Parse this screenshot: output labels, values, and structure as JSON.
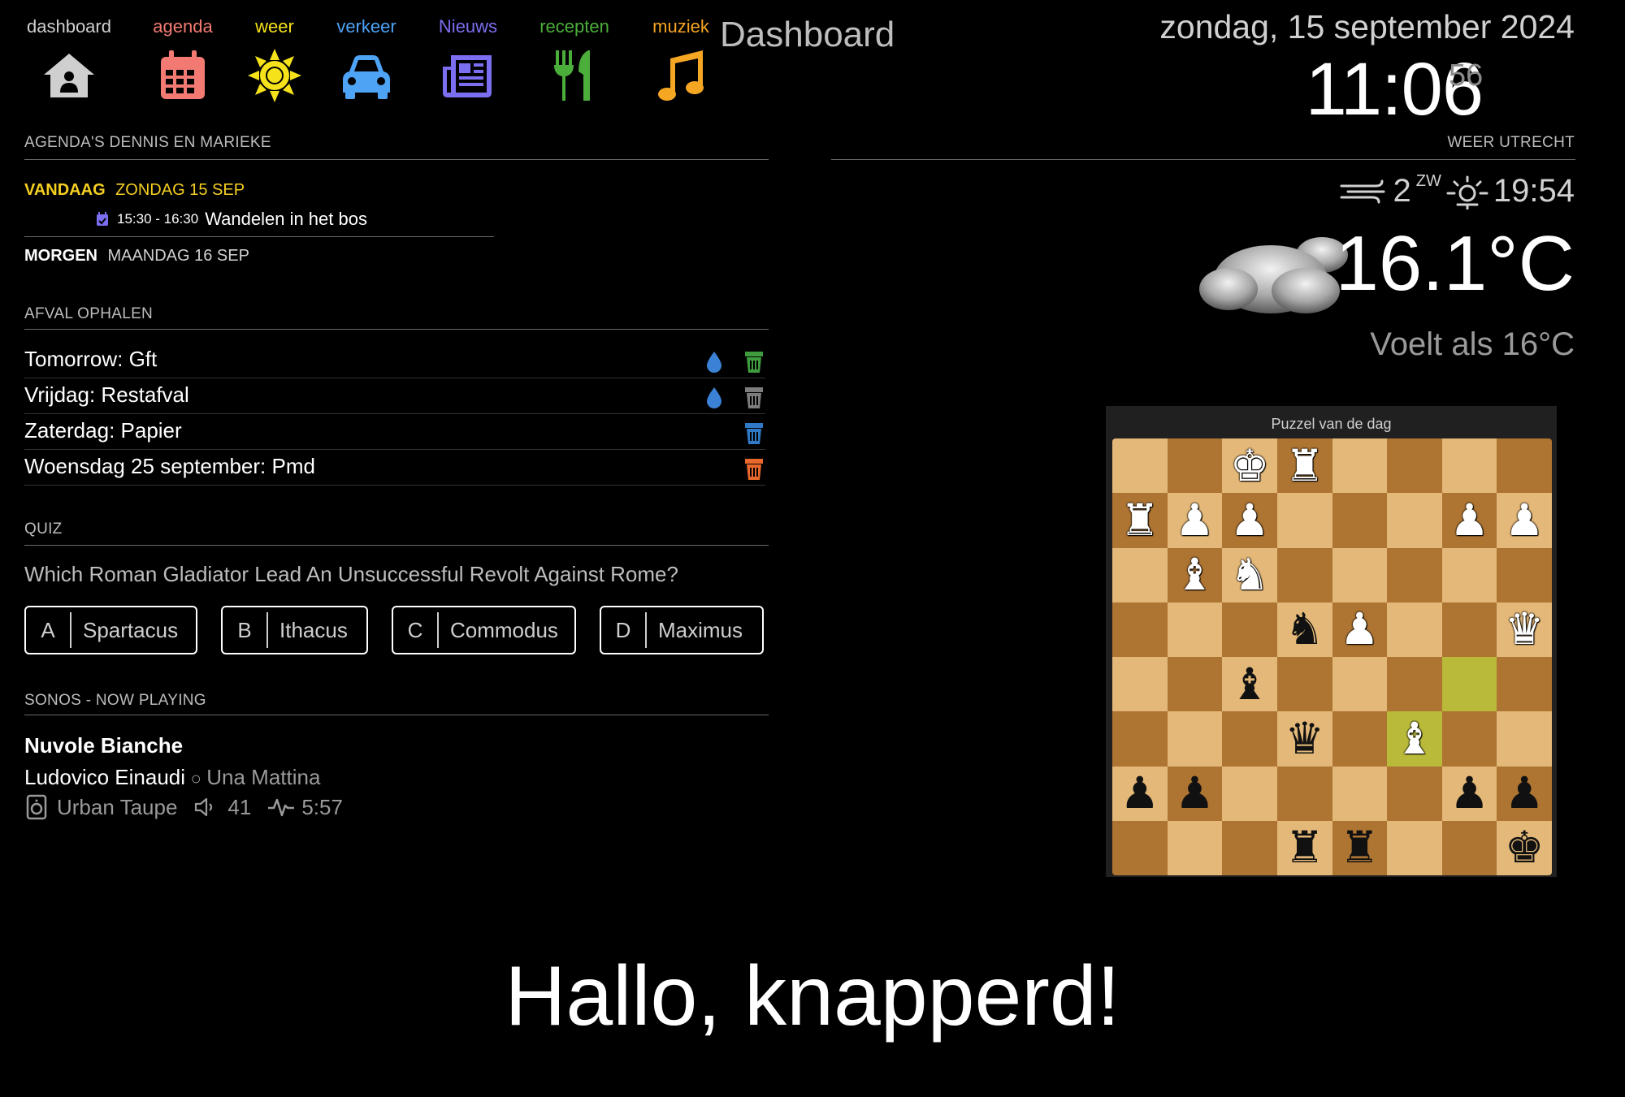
{
  "nav": [
    {
      "label": "dashboard",
      "color": "#cfcfcf",
      "icon": "home-icon"
    },
    {
      "label": "agenda",
      "color": "#f27a73",
      "icon": "calendar-icon"
    },
    {
      "label": "weer",
      "color": "#f5e21a",
      "icon": "sun-icon"
    },
    {
      "label": "verkeer",
      "color": "#4ea3f5",
      "icon": "car-icon"
    },
    {
      "label": "Nieuws",
      "color": "#7b6ef0",
      "icon": "newspaper-icon"
    },
    {
      "label": "recepten",
      "color": "#4cae3a",
      "icon": "utensils-icon"
    },
    {
      "label": "muziek",
      "color": "#f5a623",
      "icon": "music-icon"
    }
  ],
  "page_title": "Dashboard",
  "datetime": {
    "date": "zondag, 15 september 2024",
    "time": "11:06",
    "seconds": "56"
  },
  "agenda": {
    "header": "AGENDA'S DENNIS EN MARIEKE",
    "today_label": "VANDAAG",
    "today_date": "ZONDAG 15 SEP",
    "event_time": "15:30 - 16:30",
    "event_title": "Wandelen in het bos",
    "tomorrow_label": "MORGEN",
    "tomorrow_date": "MAANDAG 16 SEP"
  },
  "waste": {
    "header": "AFVAL OPHALEN",
    "items": [
      {
        "text": "Tomorrow: Gft",
        "drop": true,
        "bin_color": "#3e9b3e"
      },
      {
        "text": "Vrijdag: Restafval",
        "drop": true,
        "bin_color": "#7d7d7d"
      },
      {
        "text": "Zaterdag: Papier",
        "drop": false,
        "bin_color": "#2f79c6"
      },
      {
        "text": "Woensdag 25 september: Pmd",
        "drop": false,
        "bin_color": "#e8672a"
      }
    ]
  },
  "quiz": {
    "header": "QUIZ",
    "question": "Which Roman Gladiator Lead An Unsuccessful Revolt Against Rome?",
    "answers": [
      {
        "letter": "A",
        "text": "Spartacus"
      },
      {
        "letter": "B",
        "text": "Ithacus"
      },
      {
        "letter": "C",
        "text": "Commodus"
      },
      {
        "letter": "D",
        "text": "Maximus"
      }
    ]
  },
  "sonos": {
    "header": "SONOS - NOW PLAYING",
    "track": "Nuvole Bianche",
    "artist": "Ludovico Einaudi",
    "separator": "○",
    "album": "Una Mattina",
    "room": "Urban Taupe",
    "volume": "41",
    "duration": "5:57"
  },
  "weather": {
    "header": "WEER UTRECHT",
    "wind_speed": "2",
    "wind_dir": "ZW",
    "sunset": "19:54",
    "temperature": "16.1°C",
    "feels_like": "Voelt als 16°C"
  },
  "chess": {
    "title": "Puzzel van de dag",
    "board": [
      [
        "",
        "",
        "wK",
        "wR",
        "",
        "",
        "",
        ""
      ],
      [
        "wR",
        "wP",
        "wP",
        "",
        "",
        "",
        "wP",
        "wP"
      ],
      [
        "",
        "wB",
        "wN",
        "",
        "",
        "",
        "",
        ""
      ],
      [
        "",
        "",
        "",
        "bN",
        "wP",
        "",
        "",
        "wQ"
      ],
      [
        "",
        "",
        "bB",
        "",
        "",
        "",
        "",
        ""
      ],
      [
        "",
        "",
        "",
        "bQ",
        "",
        "wB",
        "",
        ""
      ],
      [
        "bP",
        "bP",
        "",
        "",
        "",
        "",
        "bP",
        "bP"
      ],
      [
        "",
        "",
        "",
        "bR",
        "bR",
        "",
        "",
        "bK"
      ]
    ],
    "highlighted": [
      [
        4,
        6
      ],
      [
        5,
        5
      ]
    ]
  },
  "greeting": "Hallo, knapperd!"
}
